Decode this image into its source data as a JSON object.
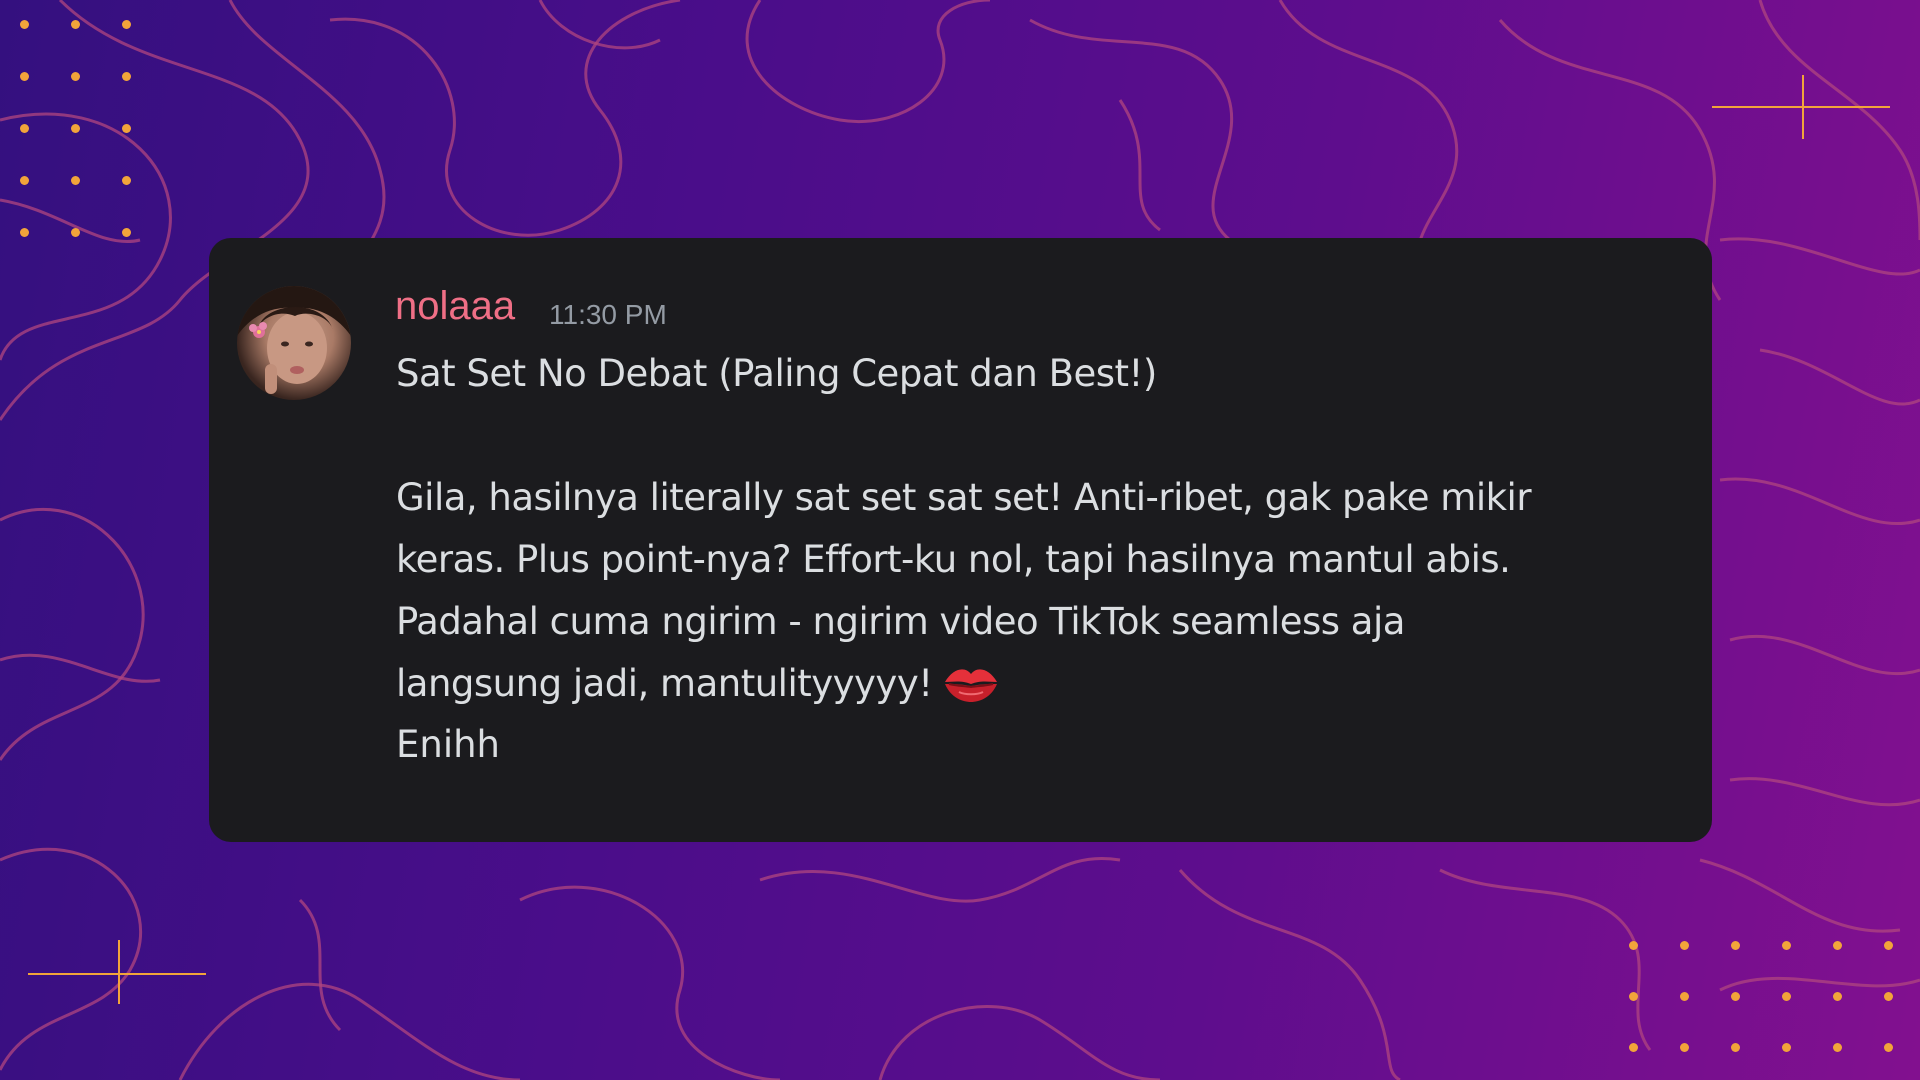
{
  "message": {
    "username": "nolaaa",
    "timestamp": "11:30 PM",
    "lines": [
      "Sat Set No Debat (Paling Cepat dan Best!)",
      "Gila, hasilnya literally sat set sat set! Anti-ribet, gak pake mikir",
      "keras. Plus point-nya? Effort-ku nol, tapi hasilnya mantul abis.",
      "Padahal cuma ngirim - ngirim video TikTok seamless aja",
      "langsung jadi, mantulityyyyy!"
    ],
    "emoji": "kiss-mark-icon",
    "followup": "Enihh"
  },
  "colors": {
    "username": "#ef6f86",
    "card": "#1b1b1e",
    "accent": "#f2a43a",
    "text": "#dbdee1",
    "timestamp": "#949ba4"
  }
}
